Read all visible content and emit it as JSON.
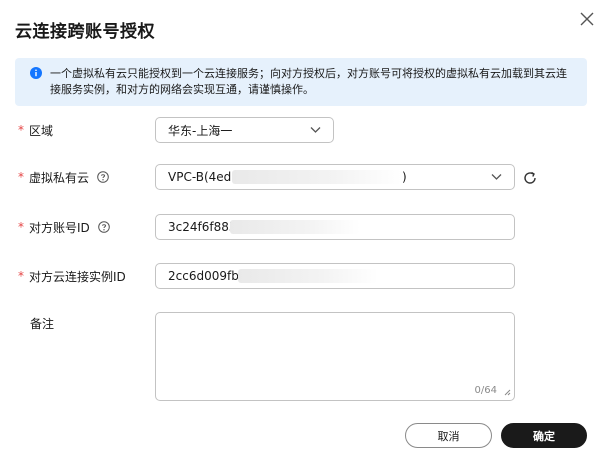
{
  "dialog": {
    "title": "云连接跨账号授权",
    "notice": "一个虚拟私有云只能授权到一个云连接服务；向对方授权后，对方账号可将授权的虚拟私有云加载到其云连接服务实例，和对方的网络会实现互通，请谨慎操作。"
  },
  "form": {
    "region": {
      "label": "区域",
      "required": "*",
      "value": "华东-上海一"
    },
    "vpc": {
      "label": "虚拟私有云",
      "required": "*",
      "value_prefix": "VPC-B(4ed0",
      "value_suffix": ")"
    },
    "peer_account": {
      "label": "对方账号ID",
      "required": "*",
      "value": "3c24f6f8852"
    },
    "peer_instance": {
      "label": "对方云连接实例ID",
      "required": "*",
      "value": "2cc6d009fbd("
    },
    "remark": {
      "label": "备注",
      "counter": "0/64"
    }
  },
  "buttons": {
    "cancel": "取消",
    "ok": "确定"
  },
  "colors": {
    "accent": "#1476ff",
    "required": "#e54545",
    "notice_bg": "#e6f1fc",
    "primary_btn": "#1a1a1a"
  },
  "icons": [
    "close-icon",
    "info-icon",
    "help-icon",
    "chevron-down-icon",
    "refresh-icon",
    "resize-handle-icon"
  ]
}
